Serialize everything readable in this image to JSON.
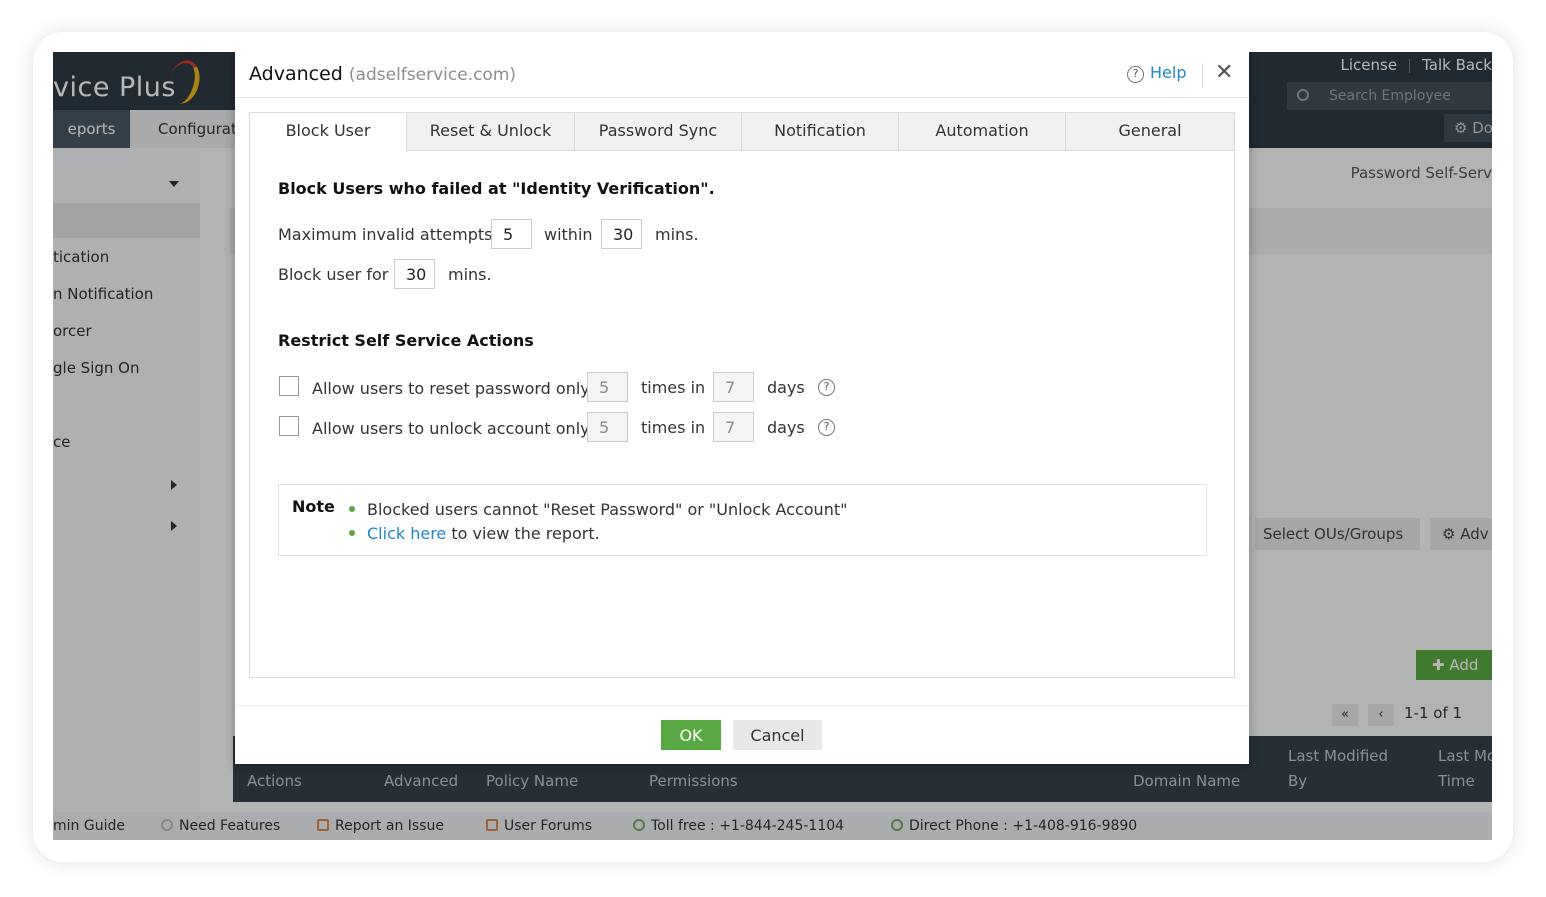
{
  "background": {
    "logo_text": "vice Plus",
    "nav": {
      "reports": "eports",
      "configuration": "Configurat"
    },
    "top_links": {
      "license": "License",
      "talk_back": "Talk Back"
    },
    "search_placeholder": "Search Employee",
    "gear_button": "Do",
    "sidebar": {
      "items": [
        "tication",
        "n Notification",
        "orcer",
        "gle Sign On",
        "ce"
      ]
    },
    "breadcrumb": "Password Self-Serv",
    "select_ous_button": "Select OUs/Groups",
    "advanced_button": "Adv",
    "add_button": "Add",
    "pager_text": "1-1 of 1",
    "table_headers": {
      "actions": "Actions",
      "advanced": "Advanced",
      "policy_name": "Policy Name",
      "permissions": "Permissions",
      "domain_name": "Domain Name",
      "last_modified_by_line1": "Last Modified",
      "last_modified_by_line2": "By",
      "last_modified_time_line1": "Last Mo",
      "last_modified_time_line2": "Time"
    },
    "footer": {
      "admin_guide": "min Guide",
      "need_features": "Need Features",
      "report_issue": "Report an Issue",
      "user_forums": "User Forums",
      "toll_free": "Toll free : +1-844-245-1104",
      "direct_phone": "Direct Phone : +1-408-916-9890"
    }
  },
  "modal": {
    "title": "Advanced",
    "subtitle": "(adselfservice.com)",
    "help": "Help",
    "close_glyph": "✕",
    "tabs": [
      "Block User",
      "Reset & Unlock",
      "Password Sync",
      "Notification",
      "Automation",
      "General"
    ],
    "active_tab": "Block User",
    "block_section": {
      "heading": "Block Users who failed at \"Identity Verification\".",
      "max_attempts_label": "Maximum invalid attempts",
      "max_attempts_value": "5",
      "within_label": "within",
      "within_value": "30",
      "mins_label": "mins.",
      "block_for_label": "Block user for",
      "block_for_value": "30",
      "block_mins_label": "mins."
    },
    "restrict_section": {
      "heading": "Restrict Self Service Actions",
      "reset": {
        "label": "Allow users to reset password only",
        "times_value": "5",
        "times_label": "times in",
        "days_value": "7",
        "days_label": "days",
        "checked": false
      },
      "unlock": {
        "label": "Allow users to unlock account only",
        "times_value": "5",
        "times_label": "times in",
        "days_value": "7",
        "days_label": "days",
        "checked": false
      }
    },
    "note": {
      "label": "Note",
      "line1": "Blocked users cannot \"Reset Password\" or \"Unlock Account\"",
      "link_text": "Click here",
      "line2_rest": " to view the report."
    },
    "ok_label": "OK",
    "cancel_label": "Cancel"
  }
}
